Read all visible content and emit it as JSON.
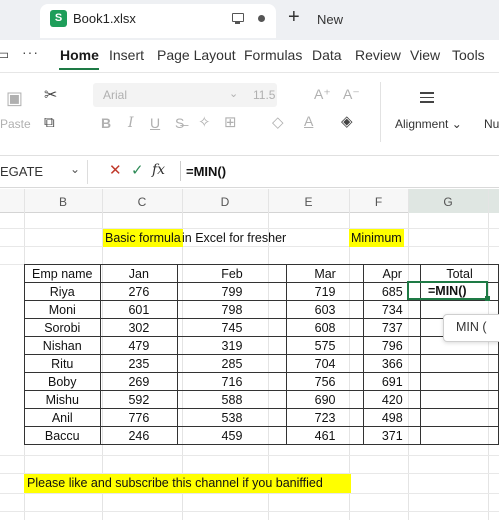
{
  "tabbar": {
    "file_name": "Book1.xlsx",
    "new_label": "New",
    "app_icon_letter": "S"
  },
  "menu": {
    "items": [
      "Home",
      "Insert",
      "Page Layout",
      "Formulas",
      "Data",
      "Review",
      "View",
      "Tools"
    ],
    "active": "Home",
    "dots": "···"
  },
  "ribbon": {
    "paste_label": "Paste",
    "font_name": "Arial",
    "font_size": "11.5",
    "alignment_label": "Alignment",
    "number_label_partial": "Nu"
  },
  "formula_bar": {
    "name_box": "EGATE",
    "fx": "fx",
    "formula": "=MIN()"
  },
  "columns": [
    "B",
    "C",
    "D",
    "E",
    "F",
    "G"
  ],
  "sheet": {
    "title_highlight": "Basic formula",
    "title_rest": "in Excel for fresher",
    "minimum_label": "Minimum",
    "footer_note": "Please like and subscribe this channel if you baniffied",
    "headers": [
      "Emp name",
      "Jan",
      "Feb",
      "Mar",
      "Apr",
      "Total"
    ],
    "rows": [
      [
        "Riya",
        "276",
        "799",
        "719",
        "685",
        ""
      ],
      [
        "Moni",
        "601",
        "798",
        "603",
        "734",
        ""
      ],
      [
        "Sorobi",
        "302",
        "745",
        "608",
        "737",
        ""
      ],
      [
        "Nishan",
        "479",
        "319",
        "575",
        "796",
        ""
      ],
      [
        "Ritu",
        "235",
        "285",
        "704",
        "366",
        ""
      ],
      [
        "Boby",
        "269",
        "716",
        "756",
        "691",
        ""
      ],
      [
        "Mishu",
        "592",
        "588",
        "690",
        "420",
        ""
      ],
      [
        "Anil",
        "776",
        "538",
        "723",
        "498",
        ""
      ],
      [
        "Baccu",
        "246",
        "459",
        "461",
        "371",
        ""
      ]
    ],
    "active_cell_text": "=MIN()",
    "autocomplete": "MIN ("
  },
  "colors": {
    "highlight": "#ffff00",
    "accent": "#1e7a45",
    "brand": "#1e9e5a"
  }
}
